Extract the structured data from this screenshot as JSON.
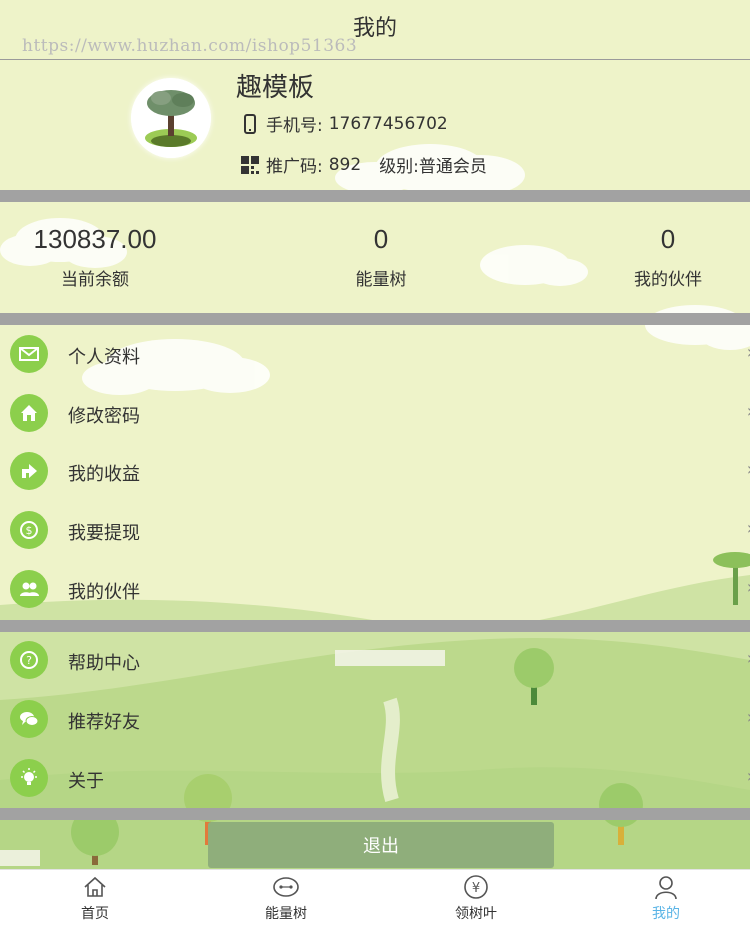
{
  "header": {
    "title": "我的",
    "watermark": "https://www.huzhan.com/ishop51363"
  },
  "profile": {
    "name": "趣模板",
    "phone_label": "手机号:",
    "phone_value": "17677456702",
    "code_label": "推广码:",
    "code_value": "892",
    "level_label": "级别:",
    "level_value": "普通会员"
  },
  "stats": [
    {
      "value": "130837.00",
      "label": "当前余额"
    },
    {
      "value": "0",
      "label": "能量树"
    },
    {
      "value": "0",
      "label": "我的伙伴"
    }
  ],
  "menu_group_1": [
    {
      "label": "个人资料",
      "icon": "mail-icon"
    },
    {
      "label": "修改密码",
      "icon": "home-icon"
    },
    {
      "label": "我的收益",
      "icon": "share-icon"
    },
    {
      "label": "我要提现",
      "icon": "dollar-coin-icon"
    },
    {
      "label": "我的伙伴",
      "icon": "people-icon"
    }
  ],
  "menu_group_2": [
    {
      "label": "帮助中心",
      "icon": "help-icon"
    },
    {
      "label": "推荐好友",
      "icon": "chat-icon"
    },
    {
      "label": "关于",
      "icon": "lightbulb-icon"
    }
  ],
  "arrow": "›",
  "logout_label": "退出",
  "tabbar": [
    {
      "label": "首页",
      "icon": "home-outline-icon",
      "active": false
    },
    {
      "label": "能量树",
      "icon": "energy-tree-icon",
      "active": false
    },
    {
      "label": "领树叶",
      "icon": "yen-coin-icon",
      "active": false
    },
    {
      "label": "我的",
      "icon": "user-icon",
      "active": true
    }
  ],
  "colors": {
    "background": "#eef3c9",
    "divider": "#a2a2a2",
    "icon_green": "#8ccf4c",
    "logout": "#8fae7b",
    "active_tab": "#5ab4e6"
  }
}
